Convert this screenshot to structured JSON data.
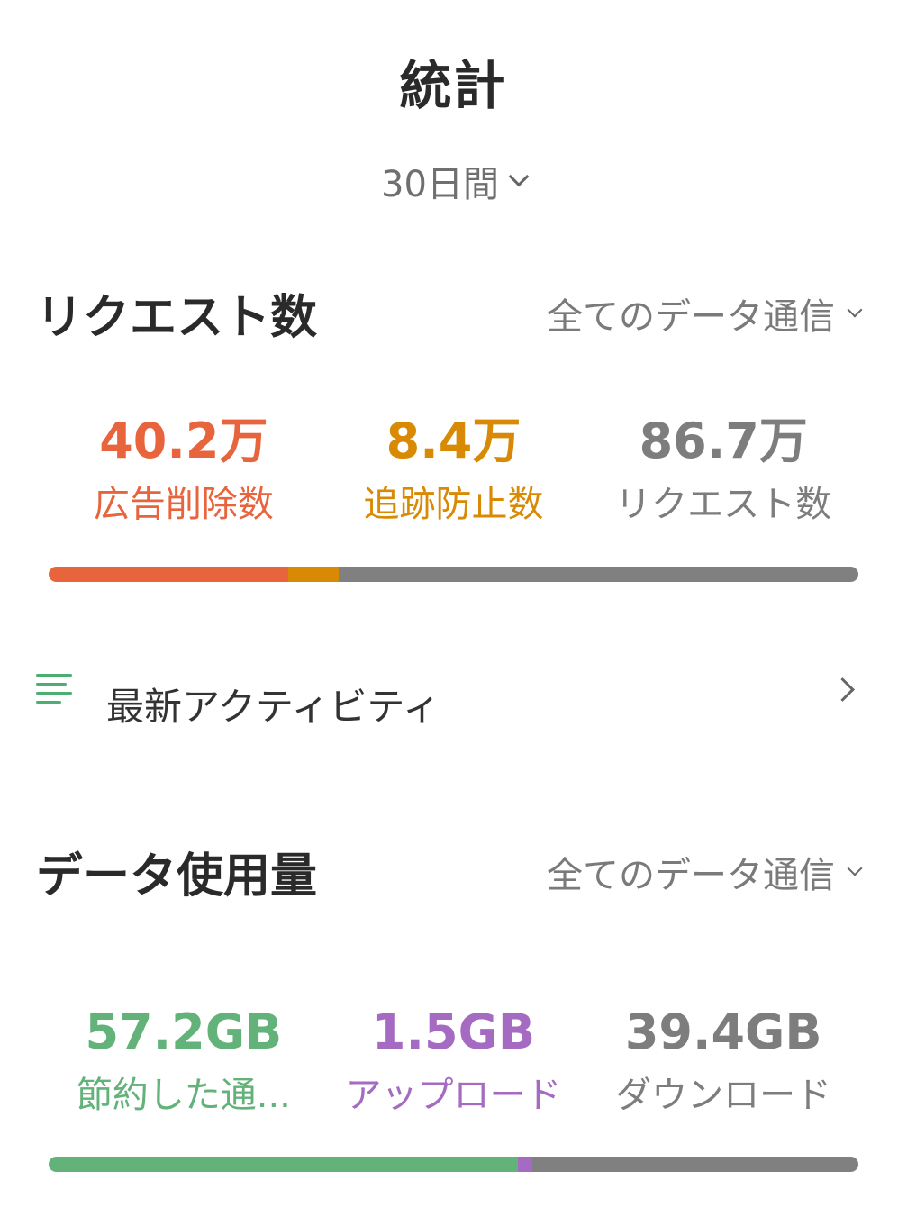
{
  "header": {
    "title": "統計",
    "period": "30日間"
  },
  "requests": {
    "title": "リクエスト数",
    "filter": "全てのデータ通信",
    "stats": [
      {
        "value": "40.2万",
        "label": "広告削除数",
        "color": "#e8643c"
      },
      {
        "value": "8.4万",
        "label": "追跡防止数",
        "color": "#d98a05"
      },
      {
        "value": "86.7万",
        "label": "リクエスト数",
        "color": "#7d7d7d"
      }
    ],
    "bar": {
      "ads_fraction": 0.296,
      "trackers_fraction": 0.062,
      "ads_color": "#e8643c",
      "trackers_color": "#d98a05",
      "rest_color": "#808080"
    }
  },
  "activity": {
    "label": "最新アクティビティ"
  },
  "data_usage": {
    "title": "データ使用量",
    "filter": "全てのデータ通信",
    "stats": [
      {
        "value": "57.2GB",
        "label": "節約した通...",
        "color": "#63b27a"
      },
      {
        "value": "1.5GB",
        "label": "アップロード",
        "color": "#a56ac2"
      },
      {
        "value": "39.4GB",
        "label": "ダウンロード",
        "color": "#7d7d7d"
      }
    ],
    "bar": {
      "saved_fraction": 0.58,
      "upload_fraction": 0.017,
      "saved_color": "#63b27a",
      "upload_color": "#a56ac2",
      "rest_color": "#808080"
    }
  }
}
